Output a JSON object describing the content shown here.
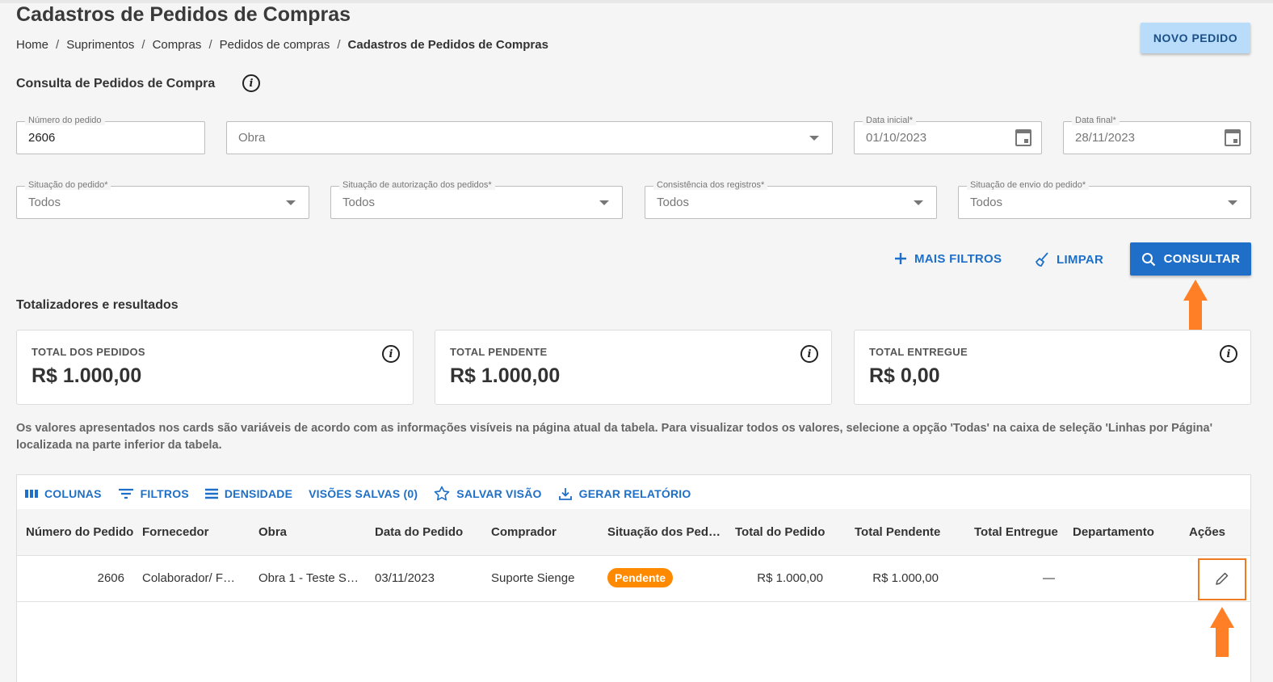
{
  "page": {
    "title": "Cadastros de Pedidos de Compras",
    "new_button": "NOVO PEDIDO"
  },
  "breadcrumb": [
    "Home",
    "Suprimentos",
    "Compras",
    "Pedidos de compras",
    "Cadastros de Pedidos de Compras"
  ],
  "breadcrumb_sep": "/",
  "filters": {
    "title": "Consulta de Pedidos de Compra",
    "numero": {
      "label": "Número do pedido",
      "value": "2606"
    },
    "obra": {
      "placeholder": "Obra"
    },
    "data_inicial": {
      "label": "Data inicial*",
      "value": "01/10/2023"
    },
    "data_final": {
      "label": "Data final*",
      "value": "28/11/2023"
    },
    "situacao": {
      "label": "Situação do pedido*",
      "value": "Todos"
    },
    "autorizacao": {
      "label": "Situação de autorização dos pedidos*",
      "value": "Todos"
    },
    "consistencia": {
      "label": "Consistência dos registros*",
      "value": "Todos"
    },
    "envio": {
      "label": "Situação de envio do pedido*",
      "value": "Todos"
    },
    "mais_filtros": "MAIS FILTROS",
    "limpar": "LIMPAR",
    "consultar": "CONSULTAR"
  },
  "totals": {
    "title": "Totalizadores e resultados",
    "cards": [
      {
        "title": "TOTAL DOS PEDIDOS",
        "value": "R$ 1.000,00"
      },
      {
        "title": "TOTAL PENDENTE",
        "value": "R$ 1.000,00"
      },
      {
        "title": "TOTAL ENTREGUE",
        "value": "R$ 0,00"
      }
    ],
    "note": "Os valores apresentados nos cards são variáveis de acordo com as informações visíveis na página atual da tabela. Para visualizar todos os valores, selecione a opção 'Todas' na caixa de seleção 'Linhas por Página' localizada na parte inferior da tabela."
  },
  "table": {
    "toolbar": {
      "colunas": "COLUNAS",
      "filtros": "FILTROS",
      "densidade": "DENSIDADE",
      "visoes": "VISÕES SALVAS (0)",
      "salvar": "SALVAR VISÃO",
      "relatorio": "GERAR RELATÓRIO"
    },
    "columns": [
      "Número do Pedido",
      "Fornecedor",
      "Obra",
      "Data do Pedido",
      "Comprador",
      "Situação dos Ped…",
      "Total do Pedido",
      "Total Pendente",
      "Total Entregue",
      "Departamento",
      "Ações"
    ],
    "rows": [
      {
        "numero": "2606",
        "fornecedor": "Colaborador/ F…",
        "obra": "Obra 1 - Teste S…",
        "data": "03/11/2023",
        "comprador": "Suporte Sienge",
        "situacao": "Pendente",
        "total_pedido": "R$ 1.000,00",
        "total_pendente": "R$ 1.000,00",
        "total_entregue": "—",
        "departamento": ""
      }
    ]
  },
  "colors": {
    "primary": "#1f6fc9",
    "badge_pending": "#ff8a00",
    "annotation": "#ff7f27"
  }
}
